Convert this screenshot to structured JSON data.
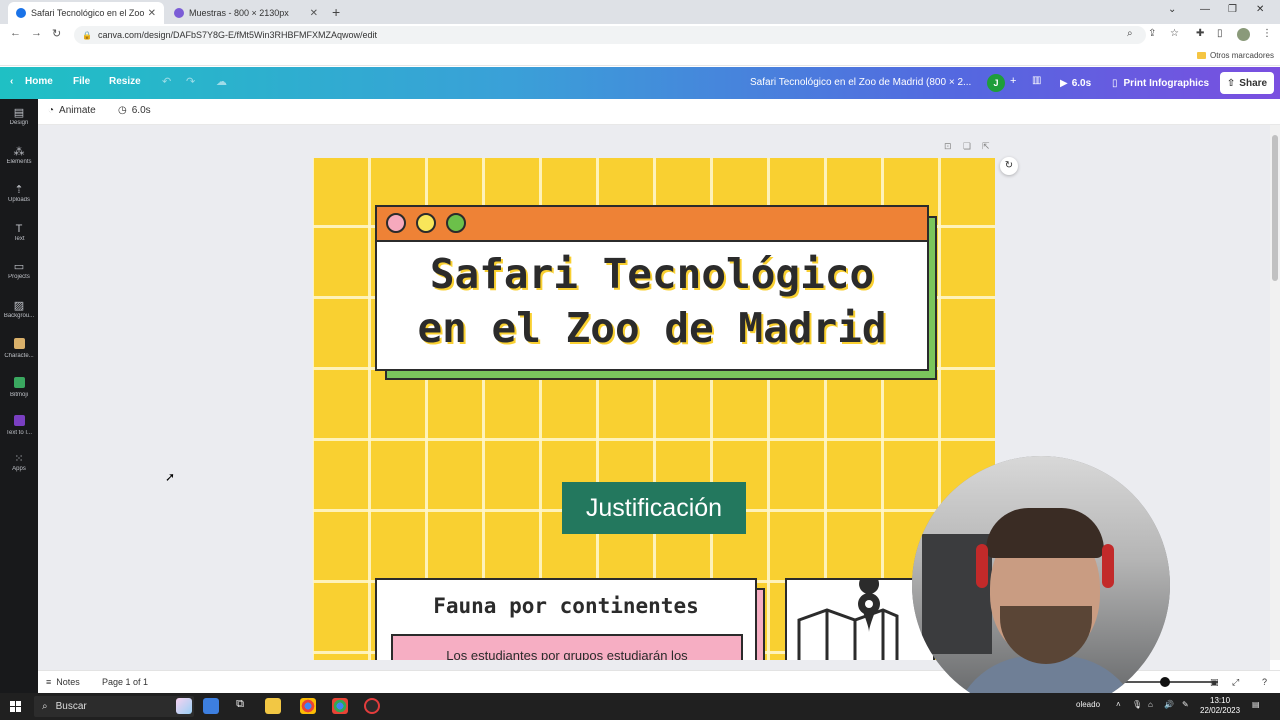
{
  "browser": {
    "tabs": [
      {
        "title": "Safari Tecnológico en el Zoo de Ma",
        "active": true
      },
      {
        "title": "Muestras - 800 × 2130px",
        "active": false
      }
    ],
    "url": "canva.com/design/DAFbS7Y8G-E/fMt5Win3RHBFMFXMZAqwow/edit",
    "bookmarks_other": "Otros marcadores"
  },
  "canva_header": {
    "home": "Home",
    "file": "File",
    "resize": "Resize",
    "doc_title": "Safari Tecnológico en el Zoo de Madrid (800 × 2...",
    "avatar_initial": "J",
    "play_duration": "6.0s",
    "print_label": "Print Infographics",
    "share_label": "Share"
  },
  "sidebar": {
    "items": [
      {
        "label": "Design",
        "icon": "layout-icon"
      },
      {
        "label": "Elements",
        "icon": "shapes-icon"
      },
      {
        "label": "Uploads",
        "icon": "upload-icon"
      },
      {
        "label": "Text",
        "icon": "text-icon"
      },
      {
        "label": "Projects",
        "icon": "folder-icon"
      },
      {
        "label": "Backgrou...",
        "icon": "background-icon"
      },
      {
        "label": "Characte...",
        "icon": "character-icon"
      },
      {
        "label": "Bitmoji",
        "icon": "bitmoji-icon"
      },
      {
        "label": "Text to I...",
        "icon": "text-to-image-icon"
      },
      {
        "label": "Apps",
        "icon": "apps-icon"
      }
    ]
  },
  "toolbar": {
    "animate": "Animate",
    "duration": "6.0s"
  },
  "design": {
    "title_line1": "Safari Tecnológico",
    "title_line2": "en el Zoo de Madrid",
    "section_label": "Justificación",
    "card_title": "Fauna por continentes",
    "card_text": "Los estudiantes por grupos estudiarán los",
    "colors": {
      "background": "#f9d031",
      "titlebar": "#ee8236",
      "shadow_green": "#7ac55c",
      "section_green": "#23785e",
      "pink": "#f6aec3"
    }
  },
  "bottom_bar": {
    "notes": "Notes",
    "page_indicator": "Page 1 of 1"
  },
  "taskbar": {
    "search_placeholder": "Buscar",
    "tray_text": "oleado",
    "time": "13:10",
    "date": "22/02/2023"
  }
}
